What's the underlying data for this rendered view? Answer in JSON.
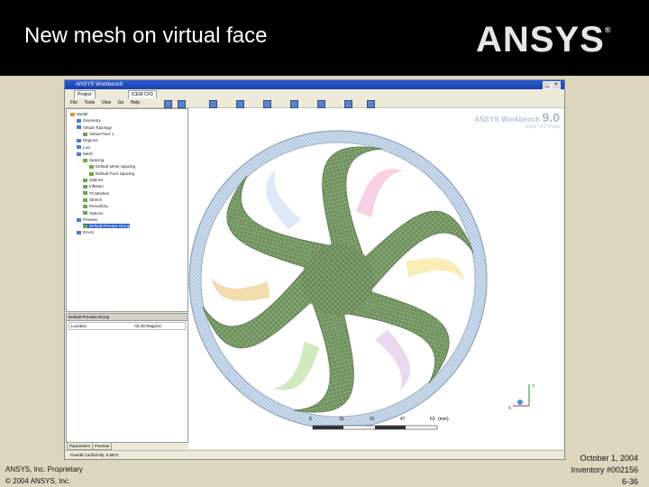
{
  "slide": {
    "title": "New mesh on virtual face",
    "logo": "ANSYS",
    "logo_mark": "®",
    "footer_left_line1": "ANSYS, Inc. Proprietary",
    "footer_left_line2": "© 2004 ANSYS, Inc.",
    "footer_right_line1": "October 1, 2004",
    "footer_right_line2": "Inventory #002156",
    "footer_right_line3": "6-36"
  },
  "window": {
    "title": "ANSYS Workbench",
    "doc_tabs": [
      "Project",
      "ICEM CFD"
    ],
    "menu": [
      "File",
      "Tools",
      "View",
      "Go",
      "Help"
    ],
    "tree": [
      {
        "label": "Model",
        "depth": 0
      },
      {
        "label": "Geometry",
        "depth": 1
      },
      {
        "label": "Virtual Topology",
        "depth": 1
      },
      {
        "label": "Virtual Face 1",
        "depth": 2
      },
      {
        "label": "Regions",
        "depth": 1
      },
      {
        "label": "Loci",
        "depth": 1
      },
      {
        "label": "Mesh",
        "depth": 1
      },
      {
        "label": "Spacing",
        "depth": 2
      },
      {
        "label": "Default Mesh Spacing",
        "depth": 3
      },
      {
        "label": "Default Face Spacing",
        "depth": 3
      },
      {
        "label": "Options",
        "depth": 2
      },
      {
        "label": "Inflation",
        "depth": 2
      },
      {
        "label": "Tri Meshes",
        "depth": 2
      },
      {
        "label": "Stretch",
        "depth": 2
      },
      {
        "label": "Periodicity",
        "depth": 2
      },
      {
        "label": "Options",
        "depth": 2
      },
      {
        "label": "Preview",
        "depth": 1
      },
      {
        "label": "Default Preview Group",
        "depth": 2,
        "selected": true
      },
      {
        "label": "Errors",
        "depth": 1
      }
    ],
    "details": {
      "header": "Default Preview Group",
      "row_label": "Location",
      "row_value": "All 2D Regions"
    },
    "bottom_tabs": [
      "Parameters",
      "Preview"
    ],
    "status": "Overall Conformity: 0.6871",
    "viewport": {
      "brand": "ANSYS Workbench",
      "version": "9.0",
      "subtitle": "ICEM CFD Prism",
      "scale_ticks": [
        "0",
        "15",
        "31",
        "47",
        "63"
      ],
      "scale_unit": "(mm)",
      "axis_y": "Y",
      "axis_x": "X"
    }
  }
}
